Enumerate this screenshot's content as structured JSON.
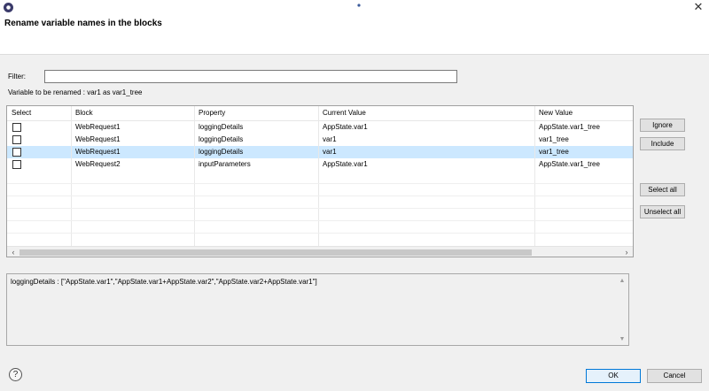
{
  "window": {
    "close_glyph": "✕",
    "icon": "app-logo-icon"
  },
  "dialog": {
    "title": "Rename variable names in the blocks"
  },
  "filter": {
    "label": "Filter:",
    "value": ""
  },
  "rename_info": "Variable to be renamed : var1 as var1_tree",
  "table": {
    "columns": [
      "Select",
      "Block",
      "Property",
      "Current Value",
      "New Value"
    ],
    "rows": [
      {
        "checked": false,
        "block": "WebRequest1",
        "property": "loggingDetails",
        "current": "AppState.var1",
        "new": "AppState.var1_tree"
      },
      {
        "checked": false,
        "block": "WebRequest1",
        "property": "loggingDetails",
        "current": "var1",
        "new": "var1_tree"
      },
      {
        "checked": false,
        "block": "WebRequest1",
        "property": "loggingDetails",
        "current": "var1",
        "new": "var1_tree"
      },
      {
        "checked": false,
        "block": "WebRequest2",
        "property": "inputParameters",
        "current": "AppState.var1",
        "new": "AppState.var1_tree"
      }
    ],
    "selected_row": 3
  },
  "side_buttons": {
    "ignore": "Ignore",
    "include": "Include",
    "select_all": "Select all",
    "unselect_all": "Unselect all"
  },
  "detail_text": "loggingDetails : [\"AppState.var1\",\"AppState.var1+AppState.var2\",\"AppState.var2+AppState.var1\"]",
  "footer": {
    "help_glyph": "?",
    "ok": "OK",
    "cancel": "Cancel"
  },
  "colors": {
    "selection": "#cce8ff",
    "ok_border": "#0078d7"
  }
}
